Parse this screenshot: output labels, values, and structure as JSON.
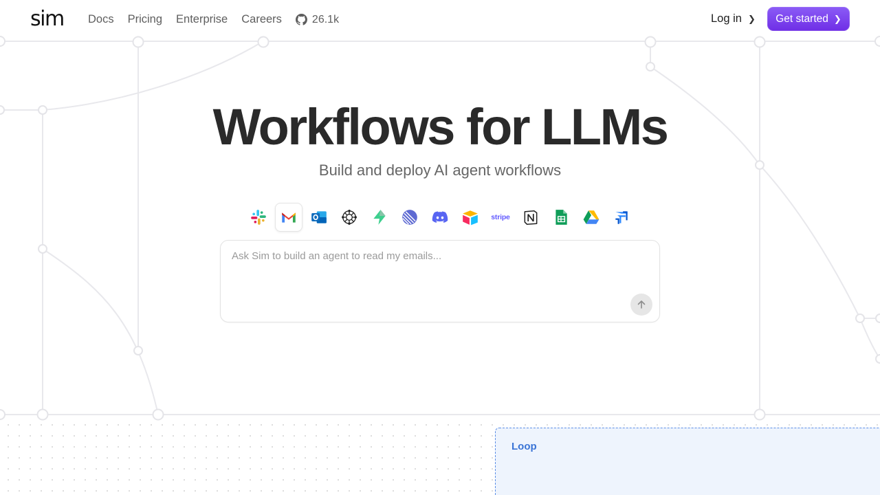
{
  "brand": {
    "logo_text": "sim"
  },
  "nav": {
    "links": [
      "Docs",
      "Pricing",
      "Enterprise",
      "Careers"
    ],
    "github_stars": "26.1k",
    "github_icon": "github-icon"
  },
  "header_actions": {
    "login_label": "Log in",
    "cta_label": "Get started",
    "accent_color": "#7c3aed"
  },
  "hero": {
    "title": "Workflows for LLMs",
    "subtitle": "Build and deploy AI agent workflows"
  },
  "integrations": {
    "selected": "gmail",
    "items": [
      {
        "name": "slack-icon"
      },
      {
        "name": "gmail-icon"
      },
      {
        "name": "outlook-icon"
      },
      {
        "name": "pinecone-icon"
      },
      {
        "name": "supabase-icon"
      },
      {
        "name": "linear-icon"
      },
      {
        "name": "discord-icon"
      },
      {
        "name": "airtable-icon"
      },
      {
        "name": "stripe-icon",
        "text": "stripe"
      },
      {
        "name": "notion-icon"
      },
      {
        "name": "google-sheets-icon"
      },
      {
        "name": "google-drive-icon"
      },
      {
        "name": "jira-icon"
      }
    ]
  },
  "prompt": {
    "placeholder": "Ask Sim to build an agent to read my emails...",
    "value": "",
    "send_icon": "arrow-up-icon"
  },
  "canvas": {
    "loop_label": "Loop",
    "loop_color": "#3a74d6"
  }
}
